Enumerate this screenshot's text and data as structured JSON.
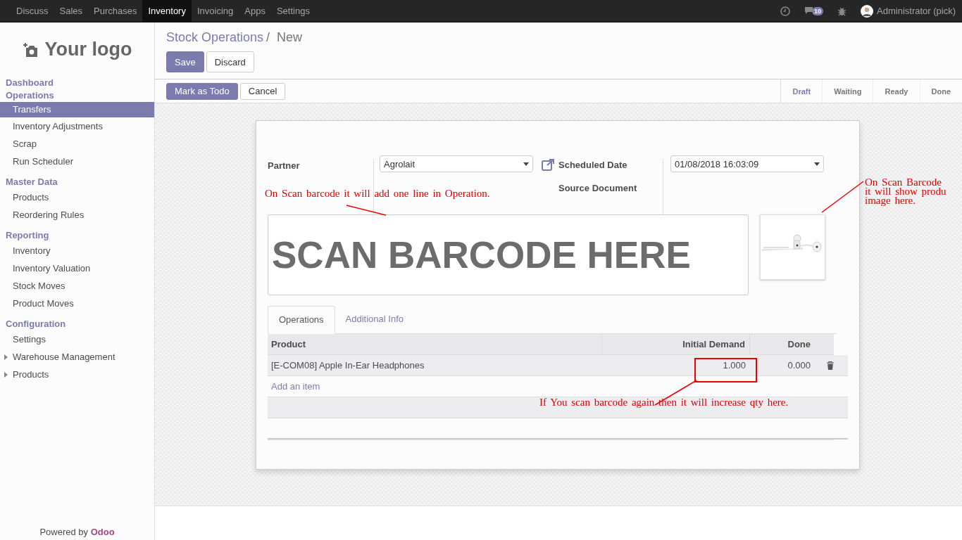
{
  "top_menu": [
    {
      "label": "Discuss",
      "selected": false
    },
    {
      "label": "Sales",
      "selected": false
    },
    {
      "label": "Purchases",
      "selected": false
    },
    {
      "label": "Inventory",
      "selected": true
    },
    {
      "label": "Invoicing",
      "selected": false
    },
    {
      "label": "Apps",
      "selected": false
    },
    {
      "label": "Settings",
      "selected": false
    }
  ],
  "systray": {
    "messages_count": "10",
    "user": "Administrator (pick)"
  },
  "logo": {
    "text": "Your logo"
  },
  "sidebar": [
    {
      "heading": "Dashboard"
    },
    {
      "heading": "Operations",
      "items": [
        {
          "label": "Transfers",
          "selected": true,
          "kind": "link"
        },
        {
          "label": "Inventory Adjustments",
          "selected": false,
          "kind": "link"
        },
        {
          "label": "Scrap",
          "selected": false,
          "kind": "link"
        },
        {
          "label": "Run Scheduler",
          "selected": false,
          "kind": "link"
        }
      ]
    },
    {
      "heading": "Master Data",
      "items": [
        {
          "label": "Products",
          "selected": false,
          "kind": "link"
        },
        {
          "label": "Reordering Rules",
          "selected": false,
          "kind": "link"
        }
      ]
    },
    {
      "heading": "Reporting",
      "items": [
        {
          "label": "Inventory",
          "selected": false,
          "kind": "link"
        },
        {
          "label": "Inventory Valuation",
          "selected": false,
          "kind": "link"
        },
        {
          "label": "Stock Moves",
          "selected": false,
          "kind": "link"
        },
        {
          "label": "Product Moves",
          "selected": false,
          "kind": "link"
        }
      ]
    },
    {
      "heading": "Configuration",
      "items": [
        {
          "label": "Settings",
          "selected": false,
          "kind": "link"
        },
        {
          "label": "Warehouse Management",
          "selected": false,
          "kind": "folder"
        },
        {
          "label": "Products",
          "selected": false,
          "kind": "folder"
        }
      ]
    }
  ],
  "powered_by": "Powered by **Odoo**",
  "breadcrumb": {
    "parent": "Stock Operations",
    "separator": "/",
    "current": "New"
  },
  "form_buttons": [
    {
      "label": "Save",
      "kind": "primary"
    },
    {
      "label": "Discard",
      "kind": "secondary"
    }
  ],
  "action_buttons": [
    {
      "label": "Mark as Todo",
      "kind": "primary"
    },
    {
      "label": "Cancel",
      "kind": "secondary"
    }
  ],
  "status_steps": [
    {
      "label": "Draft",
      "selected": true
    },
    {
      "label": "Waiting",
      "selected": false
    },
    {
      "label": "Ready",
      "selected": false
    },
    {
      "label": "Done",
      "selected": false
    }
  ],
  "fields": {
    "partner_label": "Partner",
    "partner_value": "Agrolait",
    "scheduled_label": "Scheduled Date",
    "scheduled_value": "01/08/2018 16:03:09",
    "source_label": "Source Document"
  },
  "barcode_box": {
    "text": "SCAN BARCODE HERE"
  },
  "tabs": [
    {
      "label": "Operations",
      "selected": true
    },
    {
      "label": "Additional Info",
      "selected": false
    }
  ],
  "table": {
    "columns": [
      "Product",
      "Initial Demand",
      "Done"
    ],
    "rows": [
      {
        "product": "[E-COM08] Apple In-Ear Headphones",
        "initial_demand": "1.000",
        "done": "0.000"
      }
    ],
    "add_item": "Add an item"
  },
  "annotations": [
    {
      "lines": [
        "On Scan barcode it will add one line in Operation."
      ]
    },
    {
      "lines": [
        "On Scan Barcode",
        "it will show produ",
        "image here."
      ]
    },
    {
      "lines": [
        "If You scan barcode again then it will increase qty here."
      ]
    }
  ]
}
